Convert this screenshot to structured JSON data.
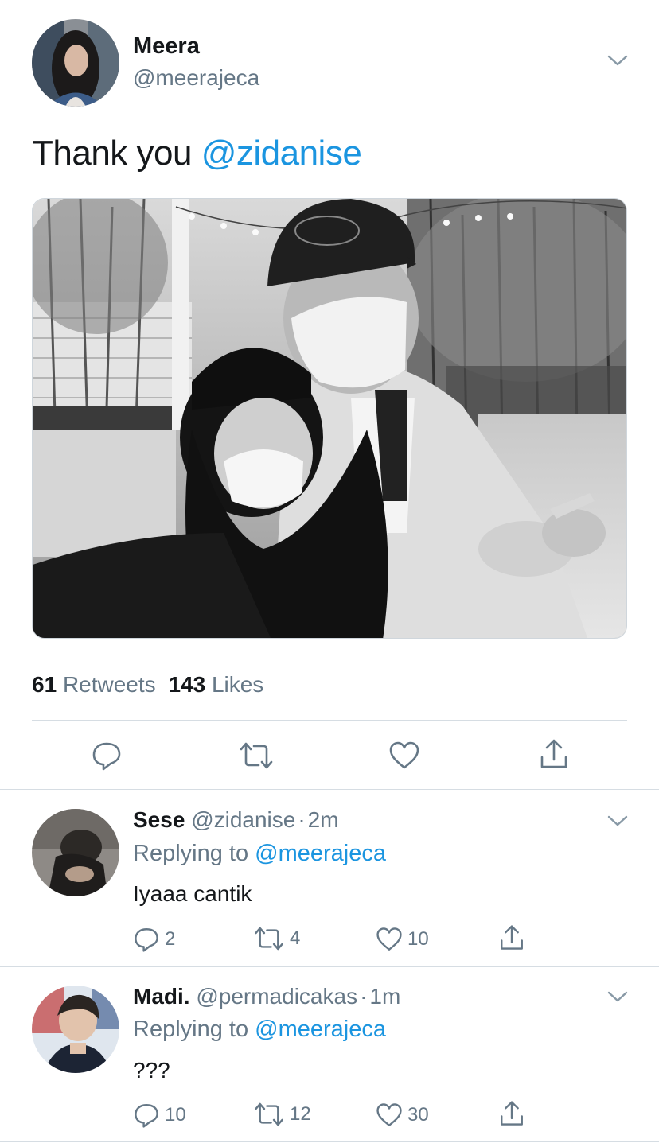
{
  "tweet": {
    "author_name": "Meera",
    "author_handle": "@meerajeca",
    "text_prefix": "Thank you ",
    "text_mention": "@zidanise",
    "retweets_count": "61",
    "retweets_label": "Retweets",
    "likes_count": "143",
    "likes_label": "Likes"
  },
  "replies": [
    {
      "name": "Sese",
      "handle": "@zidanise",
      "sep": "·",
      "time": "2m",
      "replying_label": "Replying to",
      "replying_to": "@meerajeca",
      "text": "Iyaaa cantik",
      "reply_count": "2",
      "retweet_count": "4",
      "like_count": "10"
    },
    {
      "name": "Madi.",
      "handle": "@permadicakas",
      "sep": "·",
      "time": "1m",
      "replying_label": "Replying to",
      "replying_to": "@meerajeca",
      "text": "???",
      "reply_count": "10",
      "retweet_count": "12",
      "like_count": "30"
    }
  ],
  "colors": {
    "link": "#1b95e0",
    "secondary": "#657786",
    "divider": "#d6dde3"
  }
}
